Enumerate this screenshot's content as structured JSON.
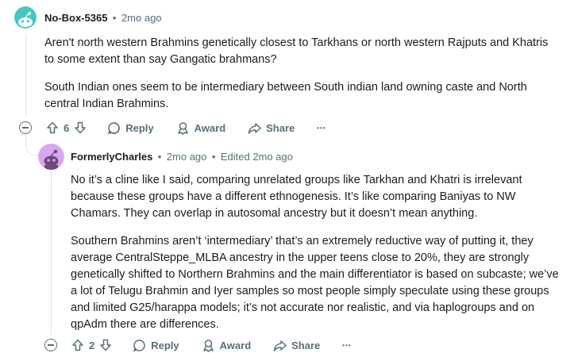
{
  "comment": {
    "author": "No-Box-5365",
    "time": "2mo ago",
    "separator": "•",
    "paragraphs": [
      "Aren't north western Brahmins genetically closest to Tarkhans or north western Rajputs and Khatris to some extent than say Gangatic brahmans?",
      "South Indian ones seem to be intermediary between South indian land owning caste and North central Indian Brahmins."
    ],
    "votes": "6",
    "actions": {
      "reply": "Reply",
      "award": "Award",
      "share": "Share",
      "more": "•••"
    },
    "avatar_color": "#41c9c4"
  },
  "reply": {
    "author": "FormerlyCharles",
    "time": "2mo ago",
    "edited": "Edited 2mo ago",
    "separator": "•",
    "paragraphs": [
      "No it’s a cline like I said, comparing unrelated groups like Tarkhan and Khatri is irrelevant because these groups have a different ethnogenesis. It’s like comparing Baniyas to NW Chamars. They can overlap in autosomal ancestry but it doesn’t mean anything.",
      "Southern Brahmins aren’t ‘intermediary’ that’s an extremely reductive way of putting it, they average CentralSteppe_MLBA ancestry in the upper teens close to 20%, they are strongly genetically shifted to Northern Brahmins and the main differentiator is based on subcaste; we’ve a lot of Telugu Brahmin and Iyer samples so most people simply speculate using these groups and limited G25/harappa models; it’s not accurate nor realistic, and via haplogroups and on qpAdm there are differences."
    ],
    "votes": "2",
    "actions": {
      "reply": "Reply",
      "award": "Award",
      "share": "Share",
      "more": "•••"
    },
    "avatar_color": "#d8a6f2"
  }
}
